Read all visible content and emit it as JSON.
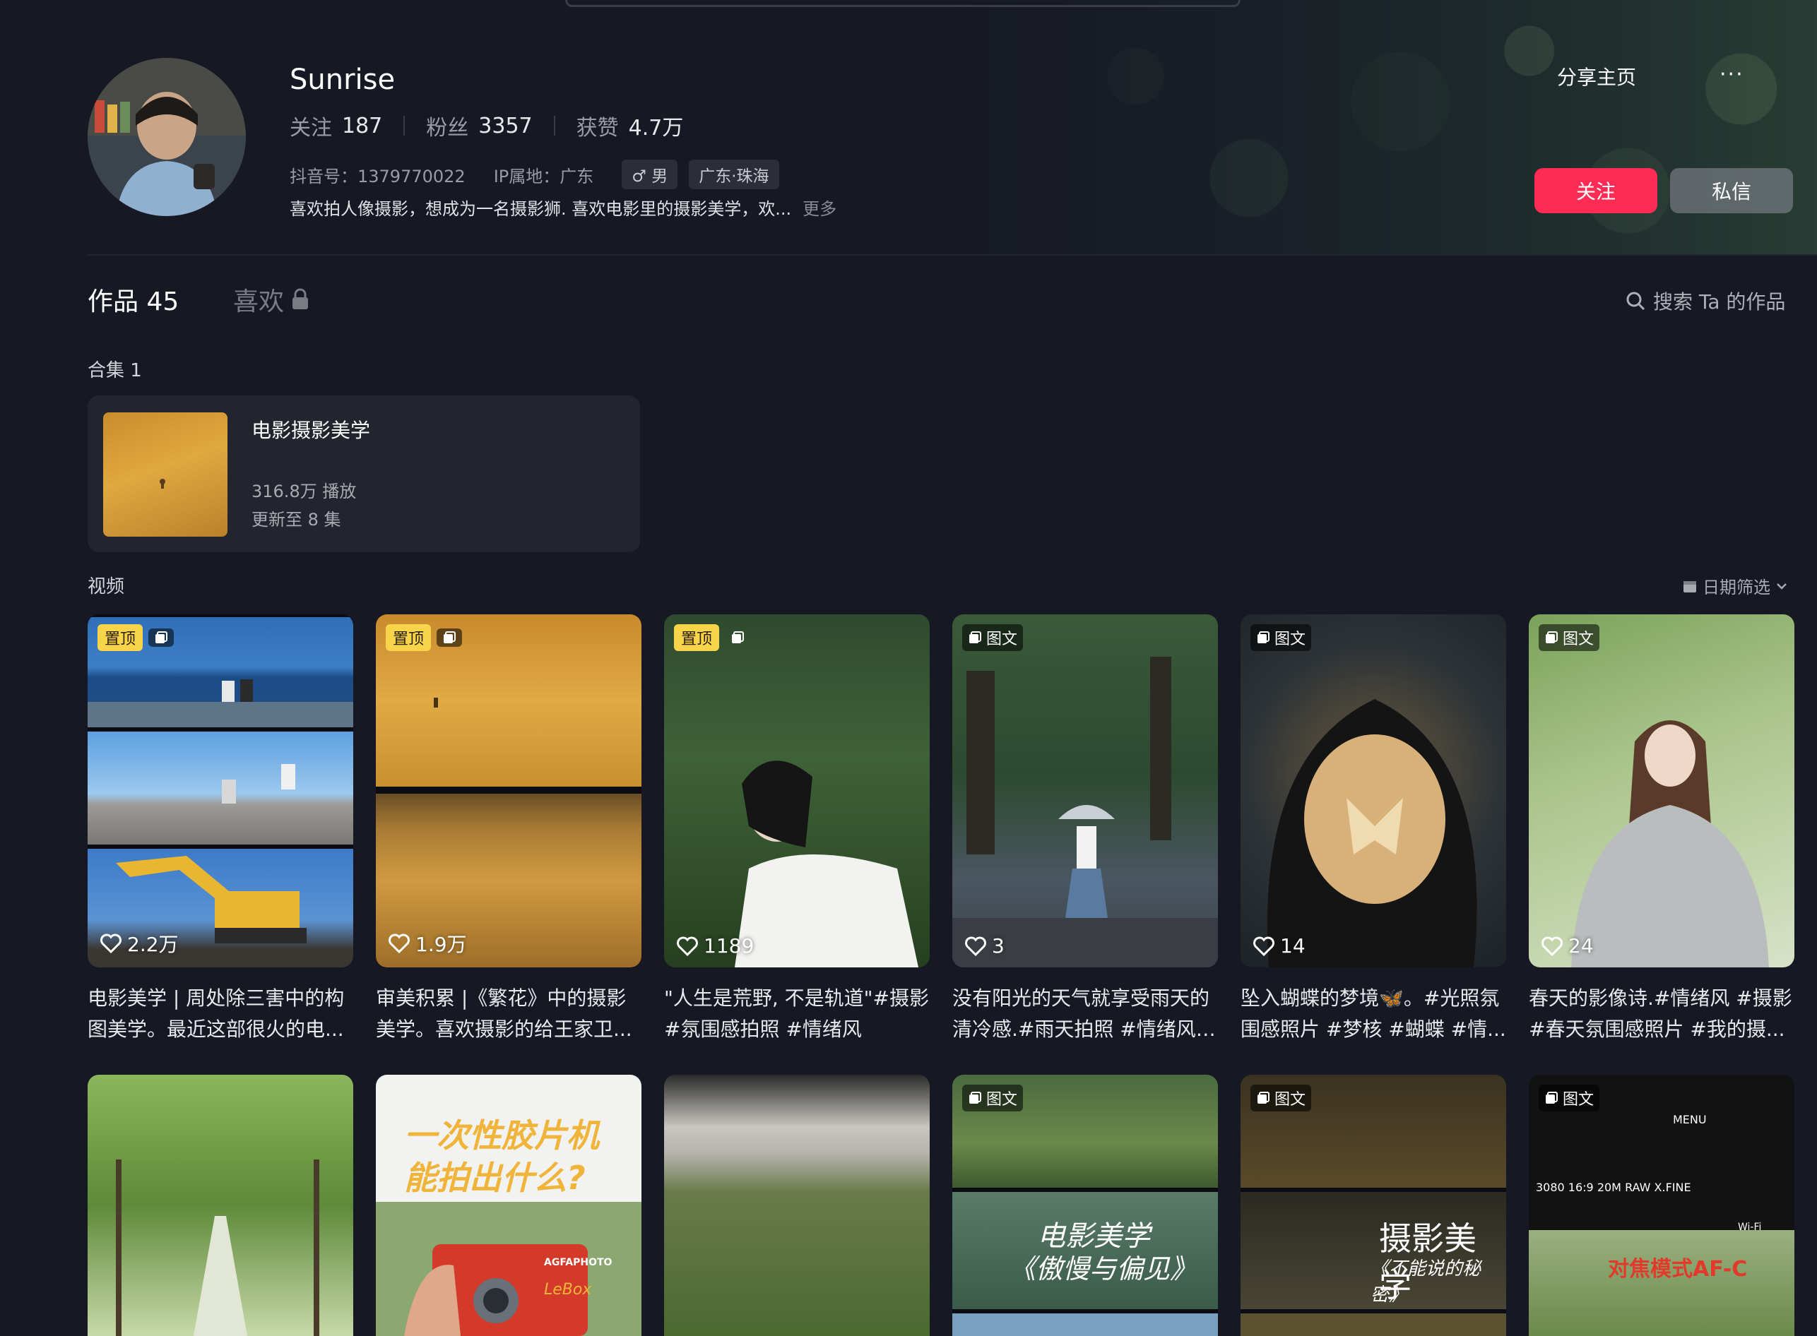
{
  "profile": {
    "name": "Sunrise",
    "following_label": "关注",
    "following": "187",
    "followers_label": "粉丝",
    "followers": "3357",
    "likes_label": "获赞",
    "likes": "4.7万",
    "douyin_id": "抖音号：1379770022",
    "ip": "IP属地：广东",
    "gender": "♂ 男",
    "location": "广东·珠海",
    "bio": "喜欢拍人像摄影，想成为一名摄影狮. 喜欢电影里的摄影美学，欢...",
    "bio_more": "更多"
  },
  "actions": {
    "share": "分享主页",
    "more": "···",
    "follow": "关注",
    "message": "私信"
  },
  "tabs": {
    "works": "作品 45",
    "likes": "喜欢",
    "search": "搜索 Ta 的作品"
  },
  "collection": {
    "section": "合集 1",
    "title": "电影摄影美学",
    "plays": "316.8万 播放",
    "updated": "更新至 8 集"
  },
  "videos": {
    "section": "视频",
    "date_filter": "日期筛选"
  },
  "labels": {
    "pinned": "置顶",
    "image_post": "图文"
  },
  "cards": [
    {
      "pinned": true,
      "type": "multi",
      "likes": "2.2万",
      "cap1": "电影美学 | 周处除三害中的构",
      "cap2": "图美学。最近这部很火的电..."
    },
    {
      "pinned": true,
      "type": "multi",
      "likes": "1.9万",
      "cap1": "审美积累 |《繁花》中的摄影",
      "cap2": "美学。喜欢摄影的给王家卫..."
    },
    {
      "pinned": true,
      "type": "video",
      "likes": "1189",
      "cap1": "\"人生是荒野, 不是轨道\"#摄影",
      "cap2": "#氛围感拍照 #情绪风"
    },
    {
      "pinned": false,
      "type": "image",
      "likes": "3",
      "cap1": "没有阳光的天气就享受雨天的",
      "cap2": "清冷感.#雨天拍照 #情绪风 ..."
    },
    {
      "pinned": false,
      "type": "image",
      "likes": "14",
      "cap1": "坠入蝴蝶的梦境🦋。#光照氛",
      "cap2": "围感照片 #梦核 #蝴蝶 #情..."
    },
    {
      "pinned": false,
      "type": "image",
      "likes": "24",
      "cap1": "春天的影像诗.#情绪风 #摄影",
      "cap2": "#春天氛围感照片 #我的摄..."
    }
  ],
  "row2": {
    "card2_text1": "一次性胶片机",
    "card2_text2": "能拍出什么?",
    "camera_brand": "AGFAPHOTO",
    "camera_model": "LeBox",
    "card4_text1": "电影美学",
    "card4_text2": "《傲慢与偏见》",
    "card5_text1": "摄影美学",
    "card5_text2": "《不能说的秘密》",
    "card6_menu": "MENU",
    "card6_info": "3080   16:9 20M RAW X.FINE",
    "card6_focus": "对焦模式AF-C",
    "card6_wifi": "Wi-Fi"
  },
  "colors": {
    "accent": "#fe2c55",
    "bg": "#161823",
    "pin": "#f7d44a"
  }
}
